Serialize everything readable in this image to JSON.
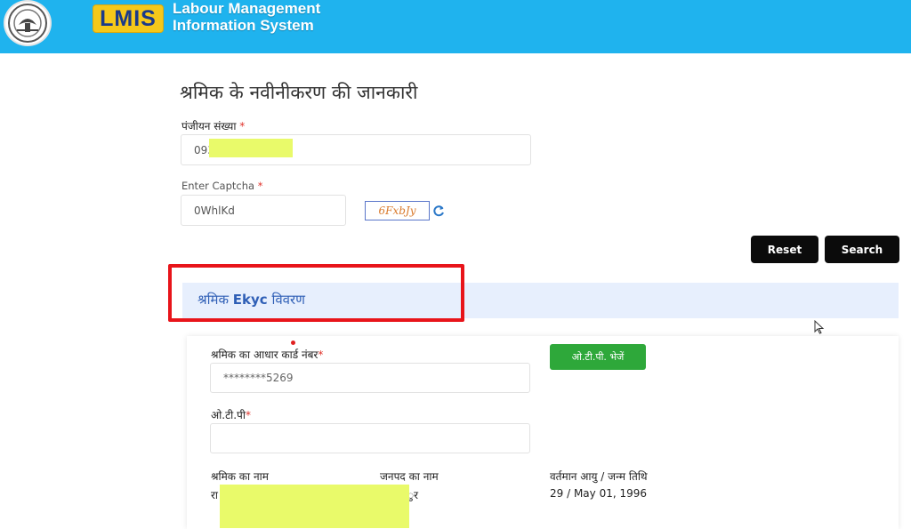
{
  "header": {
    "logo_text": "LMIS",
    "brand_line1": "Labour Management",
    "brand_line2": "Information System",
    "emblem_icon": "state-emblem-icon"
  },
  "form": {
    "title": "श्रमिक के नवीनीकरण की जानकारी",
    "registration_label": "पंजीयन संख्या",
    "registration_value": "093",
    "captcha_label": "Enter Captcha",
    "captcha_input_value": "0WhlKd",
    "captcha_image_text": "6FxbJy",
    "reset_label": "Reset",
    "search_label": "Search"
  },
  "ekyc": {
    "section_title_prefix": "श्रमिक ",
    "section_title_bold": "Ekyc",
    "section_title_suffix": " विवरण",
    "aadhaar_label": "श्रमिक का आधार कार्ड नंबर",
    "aadhaar_value": "********5269",
    "send_otp_label": "ओ.टी.पी. भेजें",
    "otp_label": "ओ.टी.पी",
    "otp_value": "",
    "worker_name_label": "श्रमिक का नाम",
    "worker_name_value": "रा",
    "district_label": "जनपद का नाम",
    "district_value": "ुर",
    "age_label": "वर्तमान आयु / जन्म तिथि",
    "age_value": "29 / May 01, 1996"
  },
  "colors": {
    "topbar": "#1fb3ee",
    "logo_bg": "#f5c81a",
    "section_bg": "#e7effd",
    "highlight": "#e8141a",
    "otp_button": "#2ea83a",
    "redaction": "#e9fa6a"
  }
}
